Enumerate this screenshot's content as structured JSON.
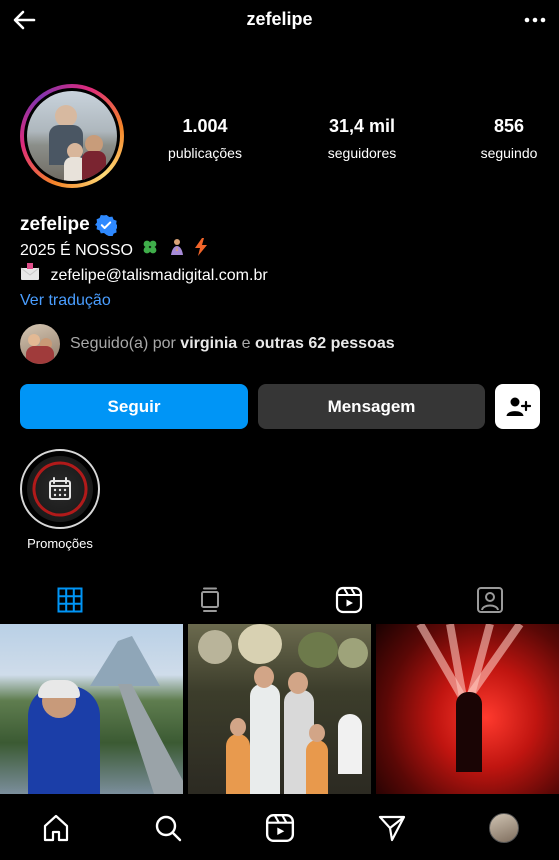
{
  "header": {
    "title": "zefelipe"
  },
  "stats": {
    "posts": {
      "value": "1.004",
      "label": "publicações"
    },
    "followers": {
      "value": "31,4 mil",
      "label": "seguidores"
    },
    "following": {
      "value": "856",
      "label": "seguindo"
    }
  },
  "bio": {
    "name": "zefelipe",
    "line1": "2025 É NOSSO",
    "line2": "zefelipe@talismadigital.com.br",
    "translate": "Ver tradução"
  },
  "followed_by": {
    "prefix": "Seguido(a) por",
    "user": "virginia",
    "mid": "e",
    "others": "outras 62 pessoas"
  },
  "actions": {
    "follow": "Seguir",
    "message": "Mensagem"
  },
  "highlights": [
    {
      "label": "Promoções"
    }
  ],
  "tabs": [
    {
      "icon": "grid-icon",
      "active": true
    },
    {
      "icon": "reels-feed-icon",
      "active": false
    },
    {
      "icon": "reels-icon",
      "active": false
    },
    {
      "icon": "tagged-icon",
      "active": false
    }
  ],
  "bottom_nav": [
    "home-icon",
    "search-icon",
    "reels-icon",
    "direct-icon",
    "profile-avatar"
  ],
  "colors": {
    "accent": "#0095f6",
    "link": "#4a9eff",
    "button_dark": "#363636"
  }
}
